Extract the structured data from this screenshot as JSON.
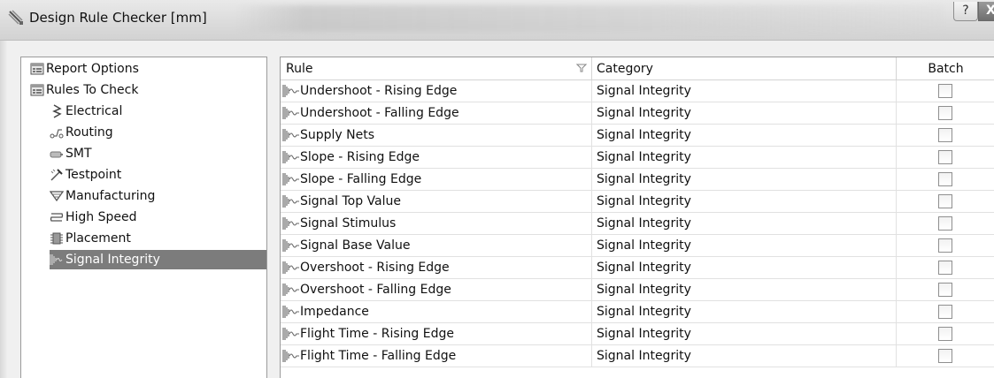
{
  "window": {
    "title": "Design Rule Checker [mm]",
    "help_label": "?",
    "close_label": "X"
  },
  "tree": {
    "items": [
      {
        "label": "Report Options",
        "icon": "report-options-icon"
      },
      {
        "label": "Rules To Check",
        "icon": "rules-to-check-icon"
      },
      {
        "label": "Electrical",
        "icon": "electrical-icon"
      },
      {
        "label": "Routing",
        "icon": "routing-icon"
      },
      {
        "label": "SMT",
        "icon": "smt-icon"
      },
      {
        "label": "Testpoint",
        "icon": "testpoint-icon"
      },
      {
        "label": "Manufacturing",
        "icon": "manufacturing-icon"
      },
      {
        "label": "High Speed",
        "icon": "high-speed-icon"
      },
      {
        "label": "Placement",
        "icon": "placement-icon"
      },
      {
        "label": "Signal Integrity",
        "icon": "signal-integrity-icon",
        "selected": true
      }
    ]
  },
  "grid": {
    "columns": {
      "rule": "Rule",
      "category": "Category",
      "batch": "Batch"
    },
    "rows": [
      {
        "rule": "Undershoot - Rising Edge",
        "category": "Signal Integrity",
        "batch": false
      },
      {
        "rule": "Undershoot - Falling Edge",
        "category": "Signal Integrity",
        "batch": false
      },
      {
        "rule": "Supply Nets",
        "category": "Signal Integrity",
        "batch": false
      },
      {
        "rule": "Slope - Rising Edge",
        "category": "Signal Integrity",
        "batch": false
      },
      {
        "rule": "Slope - Falling Edge",
        "category": "Signal Integrity",
        "batch": false
      },
      {
        "rule": "Signal Top Value",
        "category": "Signal Integrity",
        "batch": false
      },
      {
        "rule": "Signal Stimulus",
        "category": "Signal Integrity",
        "batch": false
      },
      {
        "rule": "Signal Base Value",
        "category": "Signal Integrity",
        "batch": false
      },
      {
        "rule": "Overshoot - Rising Edge",
        "category": "Signal Integrity",
        "batch": false
      },
      {
        "rule": "Overshoot - Falling Edge",
        "category": "Signal Integrity",
        "batch": false
      },
      {
        "rule": "Impedance",
        "category": "Signal Integrity",
        "batch": false
      },
      {
        "rule": "Flight Time - Rising Edge",
        "category": "Signal Integrity",
        "batch": false
      },
      {
        "rule": "Flight Time - Falling Edge",
        "category": "Signal Integrity",
        "batch": false
      }
    ]
  },
  "colors": {
    "selection": "#7c7c7c",
    "grid_line": "#e1e1e1",
    "border": "#9b9b9b"
  }
}
